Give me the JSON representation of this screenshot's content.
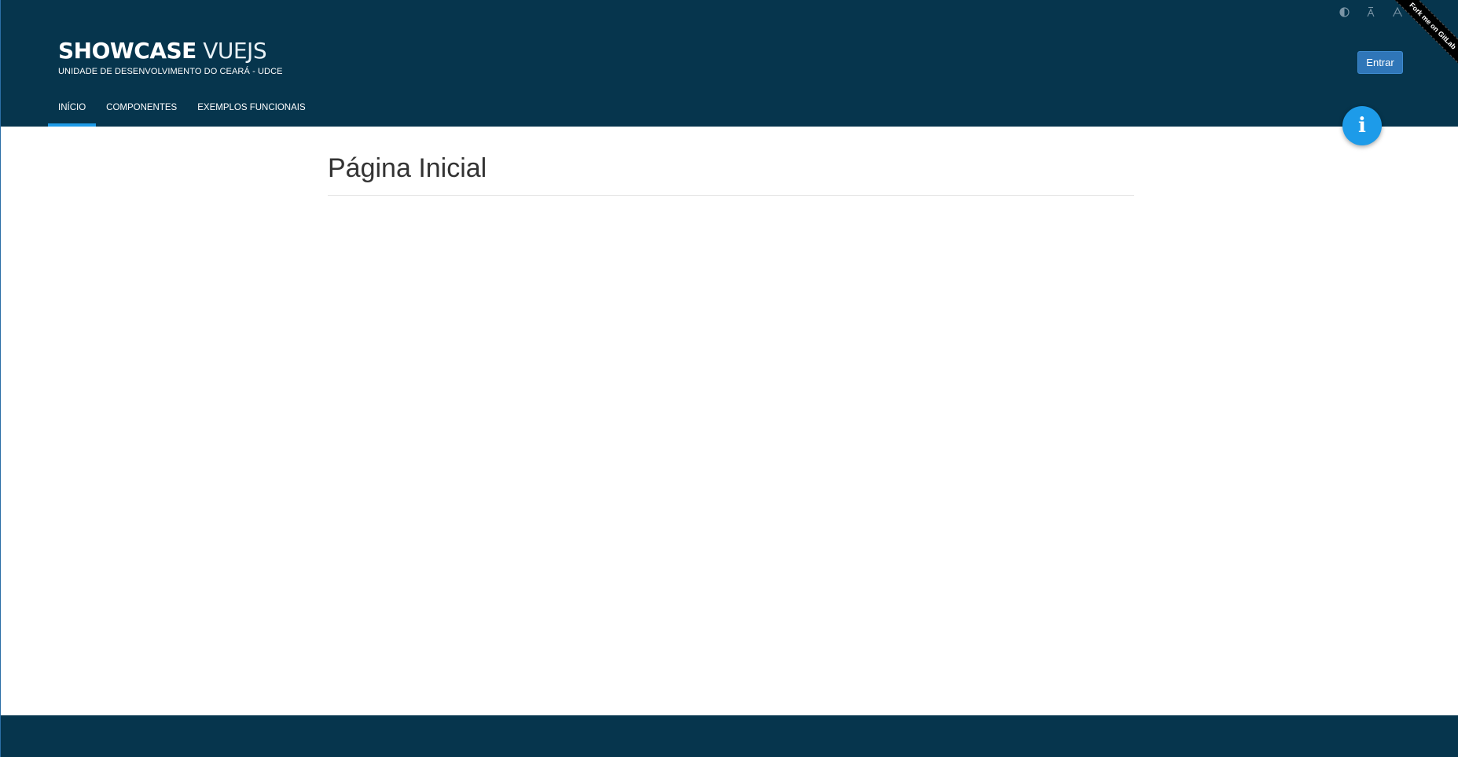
{
  "brand": {
    "title_bold": "SHOWCASE",
    "title_light": "VUEJS",
    "subtitle": "UNIDADE DE DESENVOLVIMENTO DO CEARÁ - UDCE"
  },
  "nav": {
    "items": [
      {
        "label": "INÍCIO",
        "active": true
      },
      {
        "label": "COMPONENTES",
        "active": false
      },
      {
        "label": "EXEMPLOS FUNCIONAIS",
        "active": false
      }
    ]
  },
  "accessibility": {
    "contrast_icon": "contrast-icon",
    "font_decrease_icon": "font-decrease-icon",
    "font_increase_icon": "font-increase-icon"
  },
  "header": {
    "login_label": "Entrar"
  },
  "ribbon": {
    "label": "Fork me on GitLab"
  },
  "fab": {
    "icon": "info-icon",
    "glyph": "i"
  },
  "main": {
    "title": "Página Inicial"
  },
  "colors": {
    "header_bg": "#06354d",
    "accent": "#1e9be8",
    "button": "#2f76b8"
  }
}
